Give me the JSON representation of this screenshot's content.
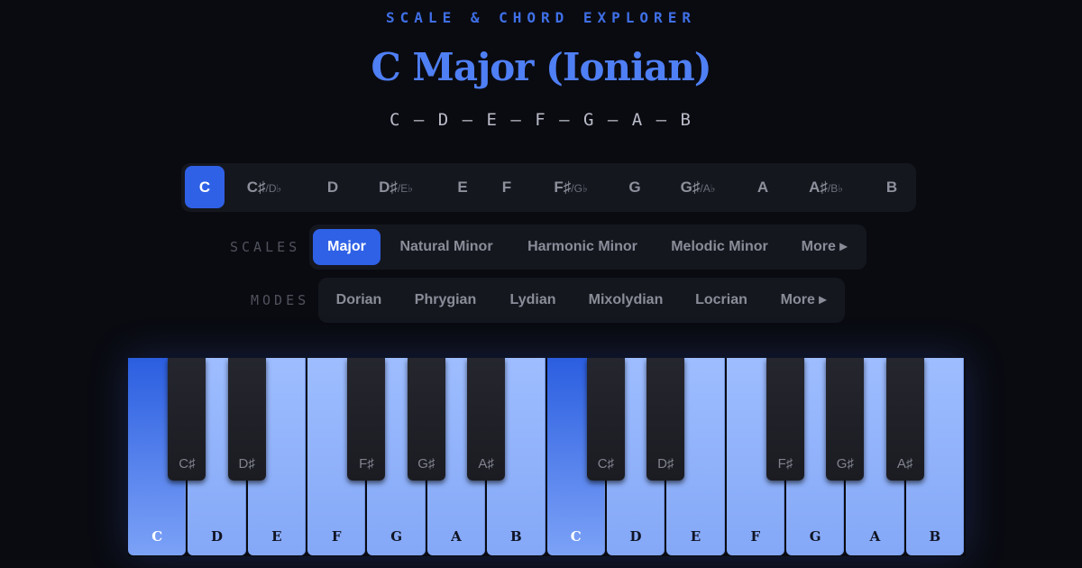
{
  "header": {
    "kicker": "SCALE & CHORD EXPLORER",
    "title": "C Major (Ionian)",
    "notes": "C – D – E – F – G – A – B"
  },
  "roots": [
    {
      "label": "C",
      "alt": "",
      "active": true
    },
    {
      "label": "C♯",
      "alt": "/D♭",
      "active": false
    },
    {
      "label": "D",
      "alt": "",
      "active": false
    },
    {
      "label": "D♯",
      "alt": "/E♭",
      "active": false
    },
    {
      "label": "E",
      "alt": "",
      "active": false
    },
    {
      "label": "F",
      "alt": "",
      "active": false
    },
    {
      "label": "F♯",
      "alt": "/G♭",
      "active": false
    },
    {
      "label": "G",
      "alt": "",
      "active": false
    },
    {
      "label": "G♯",
      "alt": "/A♭",
      "active": false
    },
    {
      "label": "A",
      "alt": "",
      "active": false
    },
    {
      "label": "A♯",
      "alt": "/B♭",
      "active": false
    },
    {
      "label": "B",
      "alt": "",
      "active": false
    }
  ],
  "scales": {
    "label": "SCALES",
    "items": [
      "Major",
      "Natural Minor",
      "Harmonic Minor",
      "Melodic Minor",
      "More ▸"
    ],
    "active": "Major"
  },
  "modes": {
    "label": "MODES",
    "items": [
      "Dorian",
      "Phrygian",
      "Lydian",
      "Mixolydian",
      "Locrian",
      "More ▸"
    ],
    "active": ""
  },
  "piano": {
    "white_keys": [
      {
        "note": "C",
        "root": true
      },
      {
        "note": "D",
        "root": false
      },
      {
        "note": "E",
        "root": false
      },
      {
        "note": "F",
        "root": false
      },
      {
        "note": "G",
        "root": false
      },
      {
        "note": "A",
        "root": false
      },
      {
        "note": "B",
        "root": false
      },
      {
        "note": "C",
        "root": true
      },
      {
        "note": "D",
        "root": false
      },
      {
        "note": "E",
        "root": false
      },
      {
        "note": "F",
        "root": false
      },
      {
        "note": "G",
        "root": false
      },
      {
        "note": "A",
        "root": false
      },
      {
        "note": "B",
        "root": false
      }
    ],
    "black_keys": [
      "C♯",
      "D♯",
      "F♯",
      "G♯",
      "A♯",
      "C♯",
      "D♯",
      "F♯",
      "G♯",
      "A♯"
    ],
    "colors": {
      "in_scale": "#9ebdff",
      "root": "#2b5ee0",
      "black": "#25262e",
      "accent": "#2f61e6"
    }
  }
}
